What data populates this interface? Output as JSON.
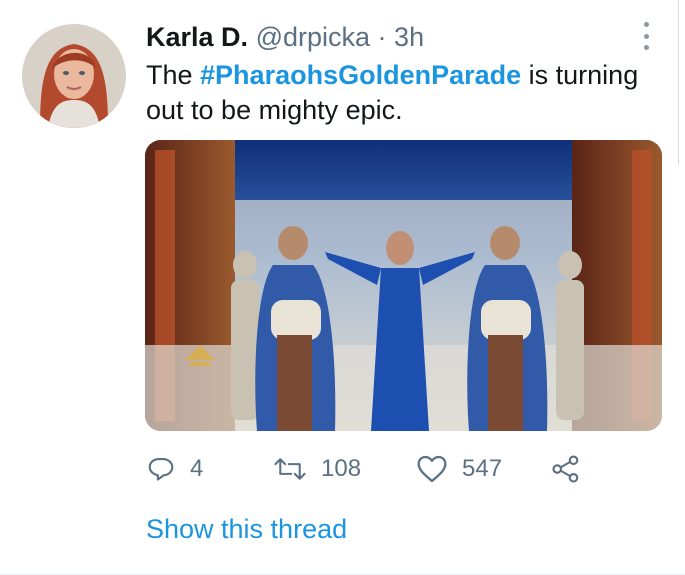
{
  "tweet": {
    "author_name": "Karla D.",
    "handle": "@drpicka",
    "separator": "·",
    "time": "3h",
    "text_prefix": "The ",
    "hashtag": "#PharaohsGoldenParade",
    "text_suffix": " is turning out to be mighty epic.",
    "avatar_icon": "profile-photo",
    "media_icon": "parade-photo"
  },
  "actions": {
    "reply": {
      "icon": "reply-icon",
      "count": "4"
    },
    "retweet": {
      "icon": "retweet-icon",
      "count": "108"
    },
    "like": {
      "icon": "heart-icon",
      "count": "547"
    },
    "share": {
      "icon": "share-icon"
    }
  },
  "show_thread": "Show this thread",
  "colors": {
    "link": "#1b95e0",
    "secondary_text": "#5b7083",
    "primary_text": "#14171a"
  }
}
